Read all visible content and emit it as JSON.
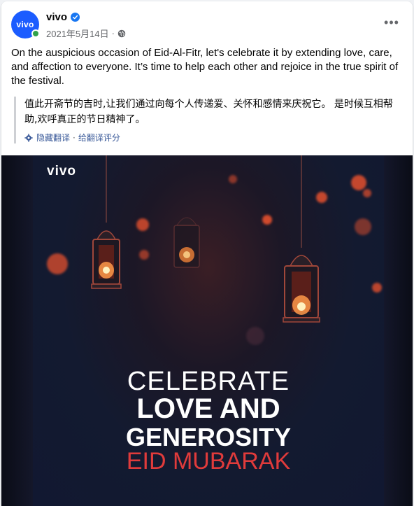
{
  "post": {
    "page_name": "vivo",
    "avatar_text": "vivo",
    "date": "2021年5月14日",
    "meta_separator": "·",
    "more_label": "•••",
    "text": "On the auspicious occasion of Eid-Al-Fitr, let's celebrate it by extending love, care, and affection to everyone. It’s time to help each other and rejoice in the true spirit of the festival."
  },
  "translation": {
    "text": "值此开斋节的吉时,让我们通过向每个人传递爱、关怀和感情来庆祝它。 是时候互相帮助,欢呼真正的节日精神了。",
    "hide_label": "隐藏翻译",
    "separator": "·",
    "rate_label": "给翻译评分"
  },
  "image": {
    "logo": "vivo",
    "line1": "CELEBRATE",
    "line2": "LOVE AND",
    "line3": "GENEROSITY",
    "line4": "EID MUBARAK"
  },
  "colors": {
    "brand": "#1b5cff",
    "link": "#385898",
    "verified": "#1877f2",
    "online": "#31a24c",
    "accent_red": "#e03b3b"
  },
  "icons": [
    "verified-badge-icon",
    "globe-icon",
    "more-options-icon",
    "gear-icon",
    "lantern-icon"
  ]
}
